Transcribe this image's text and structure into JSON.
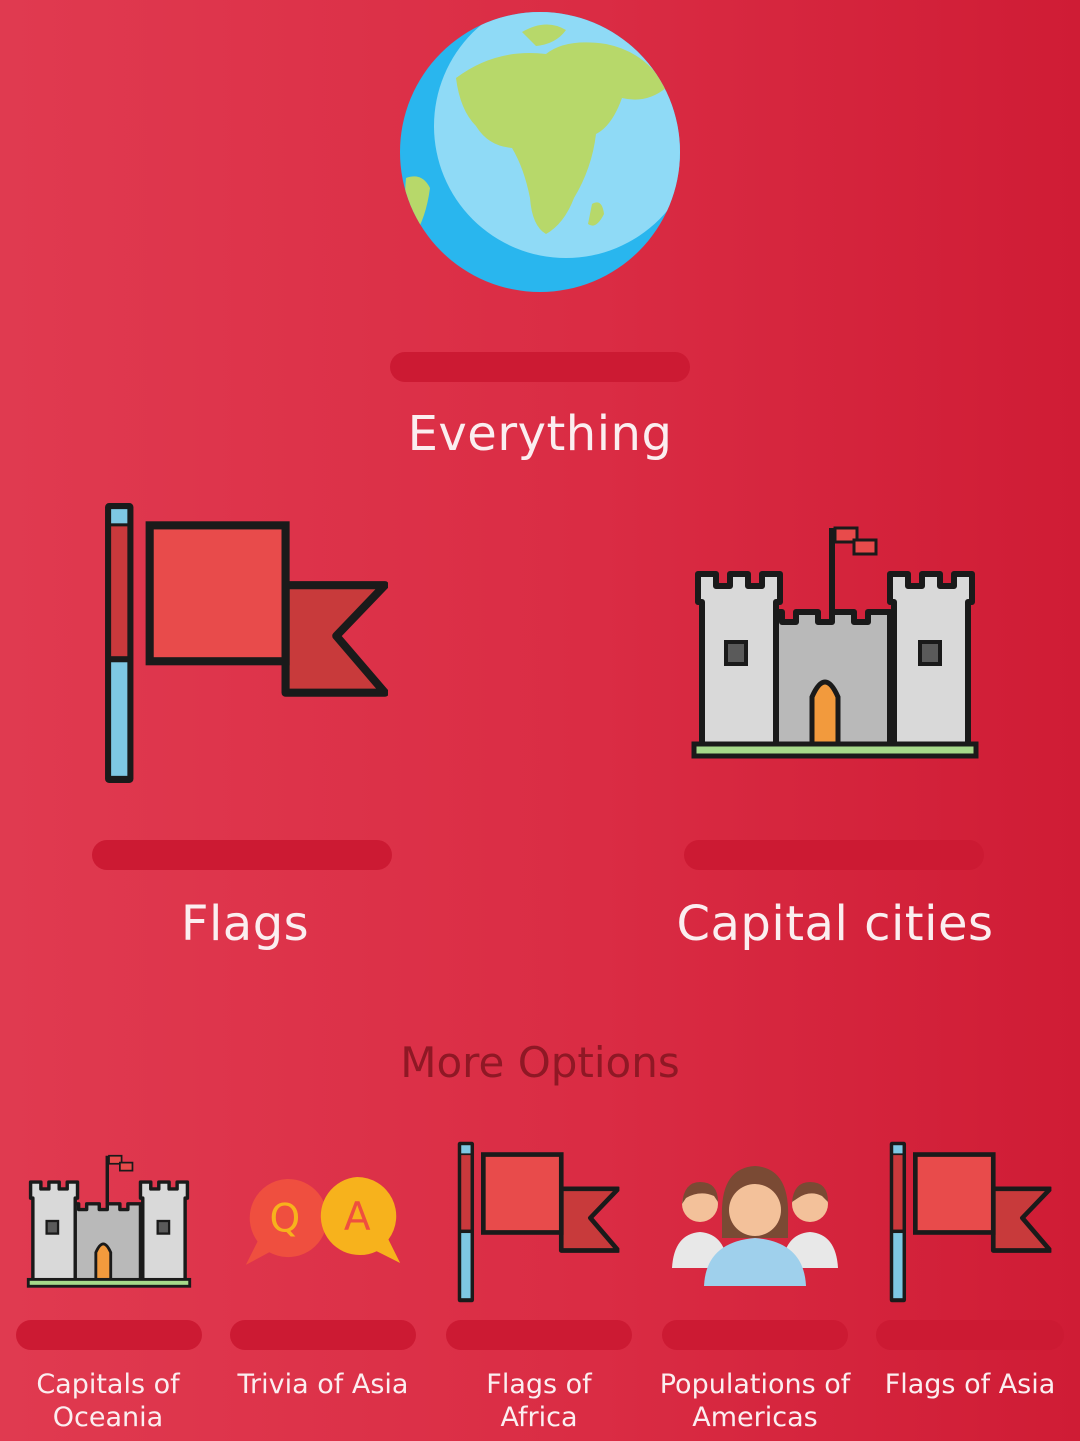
{
  "main_categories": {
    "everything": {
      "label": "Everything",
      "icon": "globe-icon"
    },
    "flags": {
      "label": "Flags",
      "icon": "flag-icon"
    },
    "capitals": {
      "label": "Capital cities",
      "icon": "castle-icon"
    }
  },
  "more_options": {
    "title": "More Options",
    "items": [
      {
        "label": "Capitals of Oceania",
        "icon": "castle-icon"
      },
      {
        "label": "Trivia of Asia",
        "icon": "qa-bubbles-icon"
      },
      {
        "label": "Flags of Africa",
        "icon": "flag-icon"
      },
      {
        "label": "Populations of Americas",
        "icon": "people-icon"
      },
      {
        "label": "Flags of Asia",
        "icon": "flag-icon"
      }
    ]
  },
  "colors": {
    "background": "#da2c44",
    "pill": "#cc1a33",
    "section_title": "#8f1825",
    "text": "#fbeef0"
  }
}
